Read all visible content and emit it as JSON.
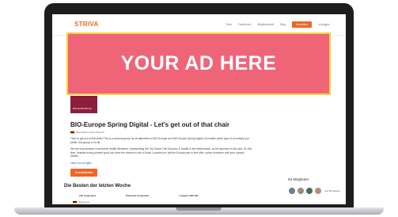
{
  "header": {
    "logo": "STRIVA",
    "nav": [
      "Start",
      "Funktionen",
      "Mitgliedschaft",
      "Blog"
    ],
    "join_label": "Anmelden",
    "login_label": "einloggen"
  },
  "ad": {
    "text": "YOUR AD HERE"
  },
  "group": {
    "logo_text": "BIO-EUROPE Spr.",
    "title": "BIO-Europe Spring Digital - Let's get out of that chair",
    "organizer": "Bischöfliche Arbeit Mensch",
    "description_1": "Time to get out of that chair! This is a workout group for all attendees of BIO-Europe and BIO-Europe Spring Digital. No matter which type of an activity you prefer, this group is for all.",
    "description_2": "We are very pleased to welcome Health Weekend, representing the Top Sector Life Sciences & Health in the Netherlands, as the sponsor of this club. So this time, besides doing yourself good you have the chance to win a Dutch Luxuries box (will be Europe part in free offer, option #conform with your contact details.",
    "link": "https://mo.do/lgffm",
    "join_button": "Jetzt beitreten"
  },
  "leaderboard": {
    "title": "Die Besten der letzten Woche",
    "columns": [
      "Ziel Insgesamt",
      "Kilometer Insgesamt",
      "Längste Aktivität"
    ],
    "row_text": "Europe pc"
  },
  "members": {
    "count_label": "63 Mitglieder",
    "more_label": "und 58 weitere"
  },
  "colors": {
    "brand_orange": "#f26522",
    "ad_pink": "#f06478",
    "ad_border": "#f6d33c",
    "group_logo": "#8d1d3b"
  }
}
